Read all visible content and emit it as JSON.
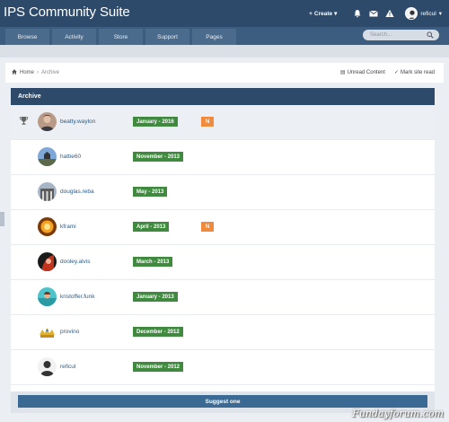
{
  "header": {
    "site_title": "IPS Community Suite",
    "create_label": "Create",
    "username": "reficul"
  },
  "nav": {
    "tabs": [
      "Browse",
      "Activity",
      "Store",
      "Support",
      "Pages"
    ],
    "search_placeholder": "Search..."
  },
  "breadcrumb": {
    "home": "Home",
    "current": "Archive",
    "unread": "Unread Content",
    "mark_read": "Mark site read"
  },
  "archive": {
    "title": "Archive",
    "rows": [
      {
        "username": "beatty.waylon",
        "date": "January - 2016",
        "badge": "N"
      },
      {
        "username": "hattie60",
        "date": "November - 2013",
        "badge": ""
      },
      {
        "username": "douglas.reba",
        "date": "May - 2013",
        "badge": ""
      },
      {
        "username": "kframi",
        "date": "April - 2013",
        "badge": "N"
      },
      {
        "username": "dooley.alvis",
        "date": "March - 2013",
        "badge": ""
      },
      {
        "username": "kristoffer.funk",
        "date": "January - 2013",
        "badge": ""
      },
      {
        "username": "provino",
        "date": "December - 2012",
        "badge": ""
      },
      {
        "username": "reficul",
        "date": "November - 2012",
        "badge": ""
      }
    ],
    "suggest_label": "Suggest one"
  },
  "watermark": "Fundayforum.com",
  "colors": {
    "header_bg": "#2d4a6a",
    "date_badge": "#3f8a3f",
    "new_badge": "#f08a3c",
    "link": "#2b5d8c"
  }
}
